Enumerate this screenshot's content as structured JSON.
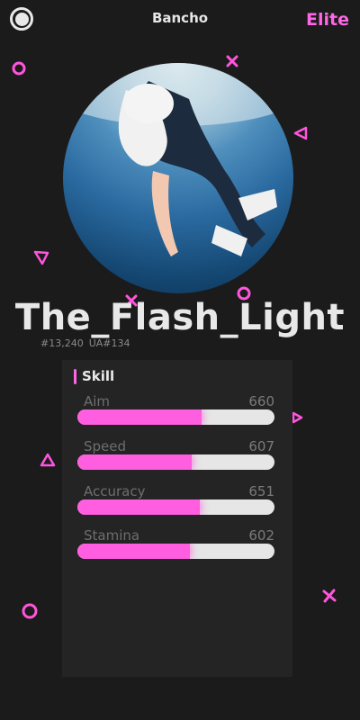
{
  "topbar": {
    "server": "Bancho",
    "mode": "Elite"
  },
  "profile": {
    "username": "The_Flash_Light",
    "global_rank": "#13,240",
    "ua_rank": "UA#134"
  },
  "skills_panel": {
    "title": "Skill",
    "items": [
      {
        "label": "Aim",
        "value": "660",
        "fill": 0.63
      },
      {
        "label": "Speed",
        "value": "607",
        "fill": 0.58
      },
      {
        "label": "Accuracy",
        "value": "651",
        "fill": 0.62
      },
      {
        "label": "Stamina",
        "value": "602",
        "fill": 0.57
      }
    ]
  },
  "colors": {
    "accent": "#ff66e6",
    "background": "#1b1b1b",
    "panel": "#242424"
  }
}
